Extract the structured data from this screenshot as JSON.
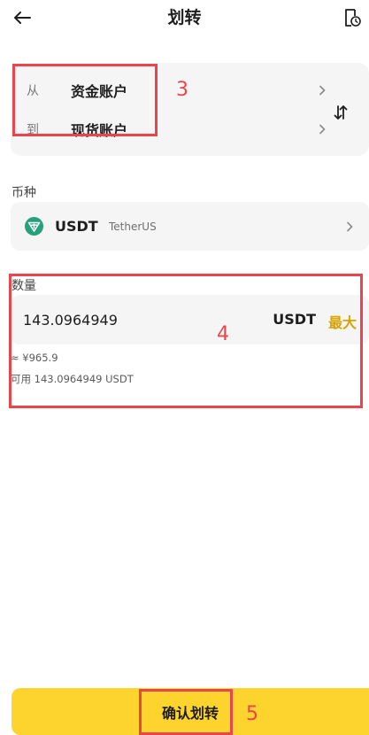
{
  "header": {
    "title": "划转"
  },
  "accounts": {
    "from_prefix": "从",
    "from_name": "资金账户",
    "to_prefix": "到",
    "to_name": "现货账户"
  },
  "coin": {
    "label": "币种",
    "symbol": "USDT",
    "name": "TetherUS",
    "icon_color": "#26a17b"
  },
  "amount": {
    "label": "数量",
    "value": "143.0964949",
    "unit": "USDT",
    "max_label": "最大",
    "approx": "≈ ¥965.9",
    "available": "可用 143.0964949 USDT"
  },
  "confirm": {
    "label": "确认划转"
  },
  "annotations": {
    "n3": "3",
    "n4": "4",
    "n5": "5",
    "color": "#e8464c"
  },
  "colors": {
    "accent": "#fdd32e",
    "max": "#d8a400",
    "card": "#f5f5f5"
  }
}
